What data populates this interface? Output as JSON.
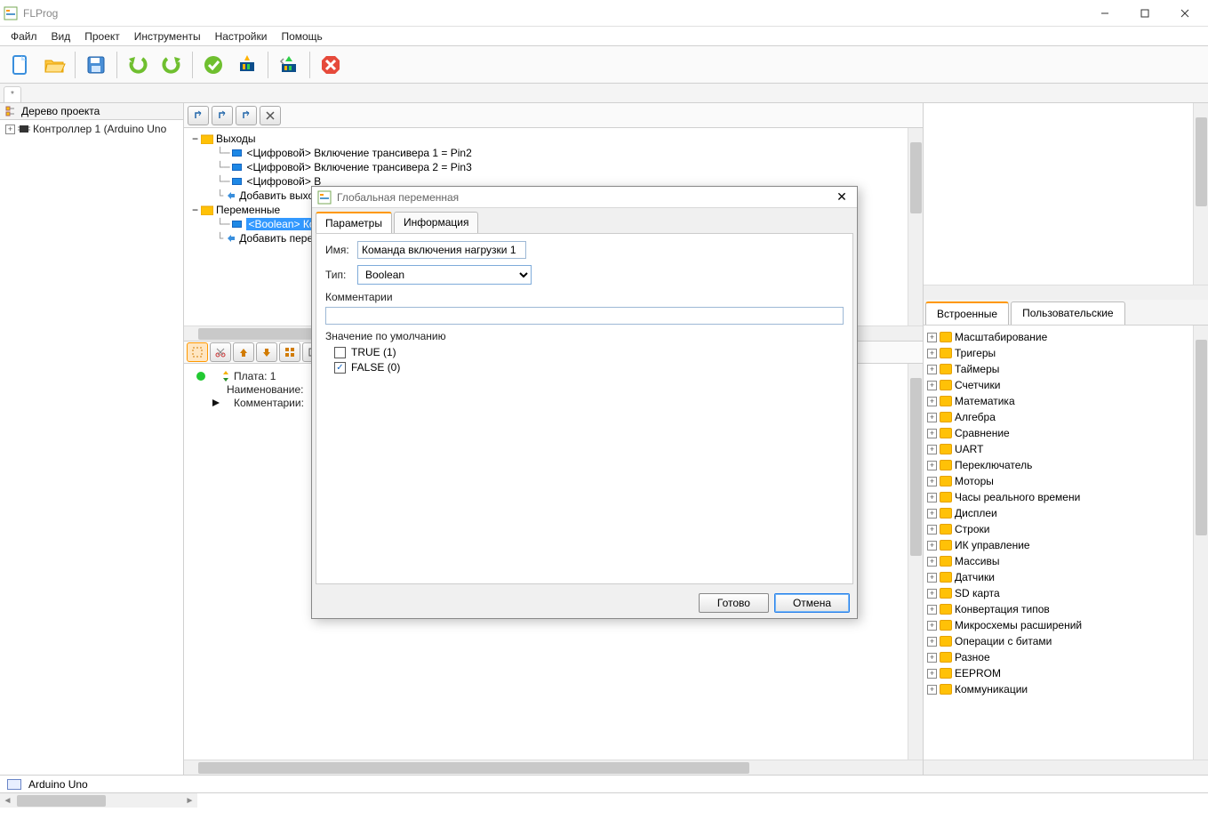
{
  "app": {
    "title": "FLProg"
  },
  "menu": [
    "Файл",
    "Вид",
    "Проект",
    "Инструменты",
    "Настройки",
    "Помощь"
  ],
  "project_tree": {
    "header": "Дерево проекта",
    "root": "Контроллер 1 (Arduino Uno"
  },
  "center_tree": {
    "outputs": "Выходы",
    "out1": "<Цифровой> Включение трансивера 1 = Pin2",
    "out2": "<Цифровой> Включение трансивера 2 = Pin3",
    "out3_prefix": "<Цифровой> В",
    "add_out": "Добавить выход",
    "variables": "Переменные",
    "var_sel": "<Boolean> Ком",
    "add_var": "Добавить пере"
  },
  "info": {
    "plate": "Плата: 1",
    "name_label": "Наименование:",
    "comment_label": "Комментарии:"
  },
  "right_tabs": {
    "tab1": "Встроенные",
    "tab2": "Пользовательские"
  },
  "right_tree": [
    "Масштабирование",
    "Тригеры",
    "Таймеры",
    "Счетчики",
    "Математика",
    "Алгебра",
    "Сравнение",
    "UART",
    "Переключатель",
    "Моторы",
    "Часы реального времени",
    "Дисплеи",
    "Строки",
    "ИК управление",
    "Массивы",
    "Датчики",
    "SD карта",
    "Конвертация типов",
    "Микросхемы расширений",
    "Операции с битами",
    "Разное",
    "EEPROM",
    "Коммуникации"
  ],
  "status": {
    "board": "Arduino Uno"
  },
  "dialog": {
    "title": "Глобальная переменная",
    "tab_params": "Параметры",
    "tab_info": "Информация",
    "name_label": "Имя:",
    "name_value": "Команда включения нагрузки 1",
    "type_label": "Тип:",
    "type_value": "Boolean",
    "comments_label": "Комментарии",
    "default_label": "Значение по умолчанию",
    "true_label": "TRUE (1)",
    "false_label": "FALSE (0)",
    "ok": "Готово",
    "cancel": "Отмена"
  }
}
